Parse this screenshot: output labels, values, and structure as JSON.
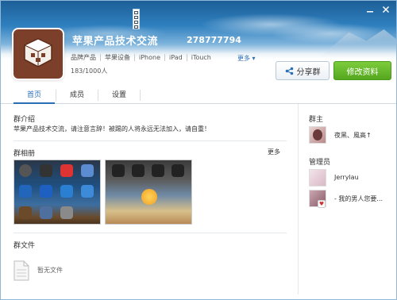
{
  "group": {
    "name": "苹果产品技术交流",
    "id": "278777794",
    "tags": [
      "品牌产品",
      "苹果设备",
      "iPhone",
      "iPad",
      "iTouch"
    ],
    "more_label": "更多",
    "members": "183/1000人"
  },
  "actions": {
    "share_label": "分享群",
    "edit_label": "修改资料"
  },
  "tabs": [
    {
      "label": "首页",
      "active": true
    },
    {
      "label": "成员",
      "active": false
    },
    {
      "label": "设置",
      "active": false
    }
  ],
  "intro": {
    "title": "群介绍",
    "text": "苹果产品技术交流，请注意言辞！被踢的人将永远无法加入，请自重！"
  },
  "albums": {
    "title": "群相册",
    "more_label": "更多"
  },
  "files": {
    "title": "群文件",
    "empty_text": "暂无文件"
  },
  "owner": {
    "title": "群主",
    "name": "夜黑、風高↑"
  },
  "admins": {
    "title": "管理员",
    "list": [
      {
        "name": "Jerrylau"
      },
      {
        "name": "- 我的男人您要..."
      }
    ]
  },
  "colors": {
    "accent": "#2a6fb6",
    "edit_button": "#5cb02a",
    "banner_top": "#1d5f98"
  },
  "icons": {
    "share": "share-icon",
    "file": "file-icon",
    "avatar": "cydia-box-icon"
  }
}
